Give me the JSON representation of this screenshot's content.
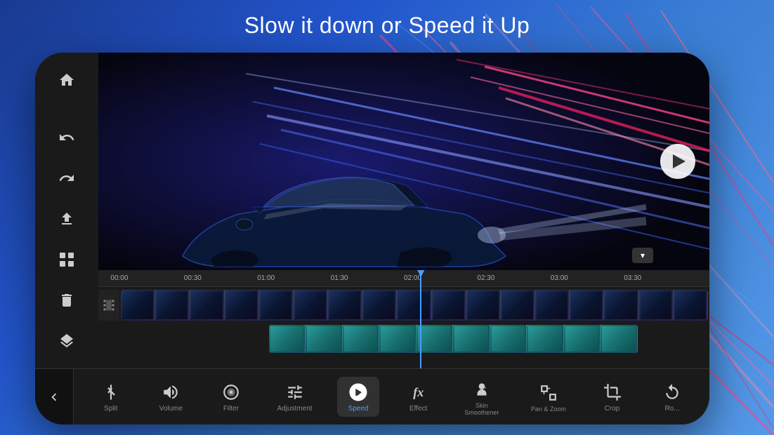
{
  "header": {
    "title": "Slow it down or Speed it Up"
  },
  "sidebar": {
    "icons": [
      {
        "name": "home-icon",
        "symbol": "⌂"
      },
      {
        "name": "undo-icon",
        "symbol": "↩"
      },
      {
        "name": "redo-icon",
        "symbol": "↪"
      },
      {
        "name": "export-icon",
        "symbol": "⬆"
      },
      {
        "name": "media-icon",
        "symbol": "▦"
      },
      {
        "name": "delete-icon",
        "symbol": "🗑"
      },
      {
        "name": "layers-icon",
        "symbol": "◈"
      }
    ]
  },
  "timeline": {
    "ruler_marks": [
      "00:00",
      "00:30",
      "01:00",
      "01:30",
      "02:00",
      "02:30",
      "03:00",
      "03:30"
    ]
  },
  "toolbar": {
    "back_label": "‹",
    "items": [
      {
        "id": "split",
        "label": "Split",
        "icon": "✂"
      },
      {
        "id": "volume",
        "label": "Volume",
        "icon": "🔊"
      },
      {
        "id": "filter",
        "label": "Filter",
        "icon": "◎"
      },
      {
        "id": "adjustment",
        "label": "Adjustment",
        "icon": "⊟"
      },
      {
        "id": "speed",
        "label": "Speed",
        "icon": "⚡",
        "active": true
      },
      {
        "id": "effect",
        "label": "Effect",
        "icon": "fx"
      },
      {
        "id": "skin",
        "label": "Skin Smoothener",
        "icon": "☺"
      },
      {
        "id": "pan_zoom",
        "label": "Pan & Zoom",
        "icon": "⊞"
      },
      {
        "id": "crop",
        "label": "Crop",
        "icon": "⊡"
      },
      {
        "id": "rotate",
        "label": "Ro...",
        "icon": "↻"
      }
    ]
  },
  "colors": {
    "accent_blue": "#4a9eff",
    "teal": "#20c0c0",
    "bg_dark": "#1a1a1a",
    "active_label": "#4a9eff"
  }
}
